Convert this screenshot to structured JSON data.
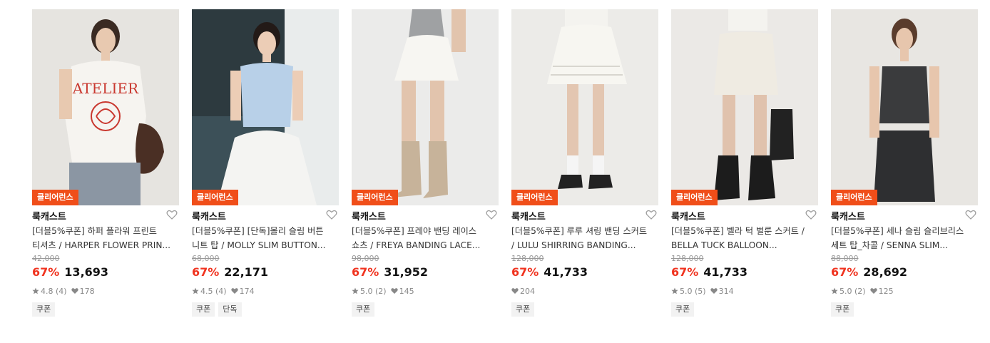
{
  "colors": {
    "badge_bg": "#f04e19",
    "discount": "#f0331f",
    "tag_bg": "#f2f2f2"
  },
  "products": [
    {
      "badge": "클리어런스",
      "brand": "룩캐스트",
      "title_line1": "[더블5%쿠폰] 하퍼 플라워 프린트",
      "title_line2": "티셔츠 / HARPER FLOWER PRIN...",
      "original_price": "42,000",
      "discount": "67%",
      "price": "13,693",
      "rating": "4.8 (4)",
      "likes": "178",
      "tags": [
        "쿠폰"
      ]
    },
    {
      "badge": "클리어런스",
      "brand": "룩캐스트",
      "title_line1": "[더블5%쿠폰] [단독]몰리 슬림 버튼",
      "title_line2": "니트 탑 / MOLLY SLIM BUTTON...",
      "original_price": "68,000",
      "discount": "67%",
      "price": "22,171",
      "rating": "4.5 (4)",
      "likes": "174",
      "tags": [
        "쿠폰",
        "단독"
      ]
    },
    {
      "badge": "클리어런스",
      "brand": "룩캐스트",
      "title_line1": "[더블5%쿠폰] 프레야 밴딩 레이스",
      "title_line2": "쇼츠 / FREYA BANDING LACE...",
      "original_price": "98,000",
      "discount": "67%",
      "price": "31,952",
      "rating": "5.0 (2)",
      "likes": "145",
      "tags": [
        "쿠폰"
      ]
    },
    {
      "badge": "클리어런스",
      "brand": "룩캐스트",
      "title_line1": "[더블5%쿠폰] 루루 셔링 밴딩 스커트",
      "title_line2": "/ LULU SHIRRING BANDING...",
      "original_price": "128,000",
      "discount": "67%",
      "price": "41,733",
      "rating": "",
      "likes": "204",
      "tags": [
        "쿠폰"
      ]
    },
    {
      "badge": "클리어런스",
      "brand": "룩캐스트",
      "title_line1": "[더블5%쿠폰] 벨라 턱 벌룬 스커트 /",
      "title_line2": "BELLA TUCK BALLOON...",
      "original_price": "128,000",
      "discount": "67%",
      "price": "41,733",
      "rating": "5.0 (5)",
      "likes": "314",
      "tags": [
        "쿠폰"
      ]
    },
    {
      "badge": "클리어런스",
      "brand": "룩캐스트",
      "title_line1": "[더블5%쿠폰] 세나 슬림 슬리브리스",
      "title_line2": "세트 탑_차콜 / SENNA SLIM...",
      "original_price": "88,000",
      "discount": "67%",
      "price": "28,692",
      "rating": "5.0 (2)",
      "likes": "125",
      "tags": [
        "쿠폰"
      ]
    }
  ]
}
